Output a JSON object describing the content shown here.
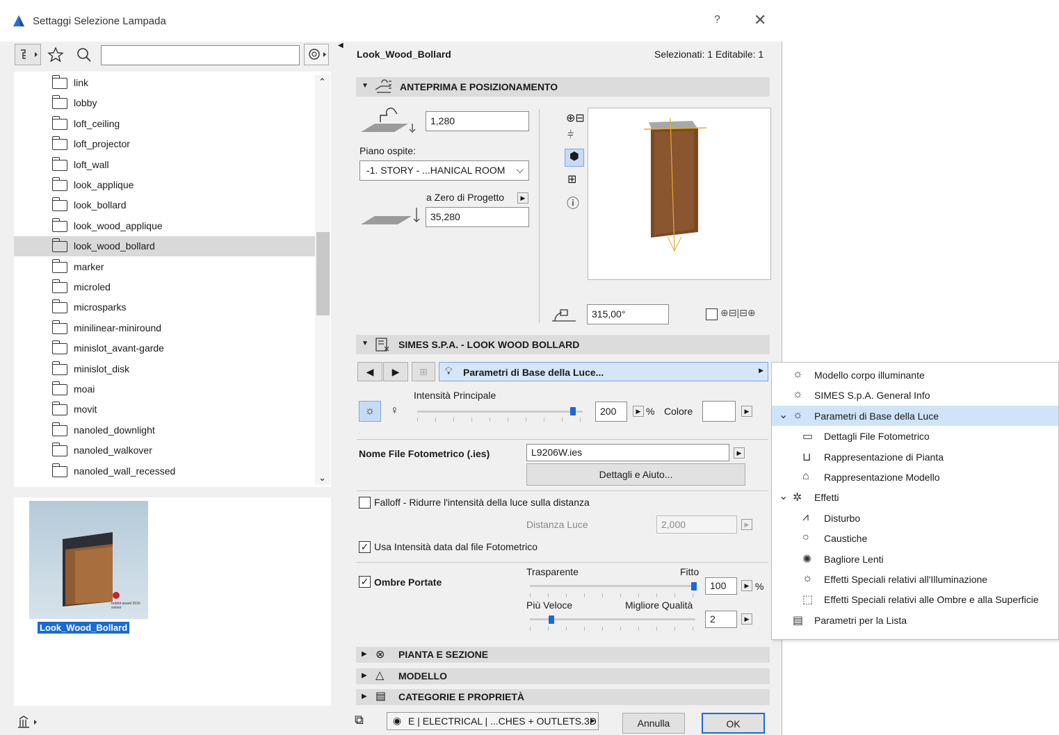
{
  "window": {
    "title": "Settaggi Selezione Lampada",
    "help": "?",
    "close": "✕"
  },
  "left": {
    "search_placeholder": "",
    "tree_items": [
      "link",
      "lobby",
      "loft_ceiling",
      "loft_projector",
      "loft_wall",
      "look_applique",
      "look_bollard",
      "look_wood_applique",
      "look_wood_bollard",
      "marker",
      "microled",
      "microsparks",
      "minilinear-miniround",
      "minislot_avant-garde",
      "minislot_disk",
      "moai",
      "movit",
      "nanoled_downlight",
      "nanoled_walkover",
      "nanoled_wall_recessed"
    ],
    "selected_item": "look_wood_bollard",
    "preview_caption": "Look_Wood_Bollard",
    "preview_badge": "reddot award 2016 winner"
  },
  "header": {
    "object_name": "Look_Wood_Bollard",
    "selection_info": "Selezionati: 1 Editabile: 1"
  },
  "anteprima": {
    "title": "ANTEPRIMA E POSIZIONAMENTO",
    "height_value": "1,280",
    "host_label": "Piano ospite:",
    "host_value": "-1. STORY - ...HANICAL ROOM",
    "ref_label": "a Zero di Progetto",
    "elev_value": "35,280",
    "angle_value": "315,00°"
  },
  "simes": {
    "title": "SIMES S.P.A. - LOOK WOOD BOLLARD",
    "page_selector": "Parametri di Base della Luce...",
    "intensity_label": "Intensità Principale",
    "intensity_value": "200",
    "intensity_unit": "%",
    "intensity_fraction": 0.94,
    "color_label": "Colore",
    "ies_label": "Nome File Fotometrico (.ies)",
    "ies_value": "L9206W.ies",
    "details_button": "Dettagli e Aiuto...",
    "falloff_label": "Falloff - Ridurre l'intensità della luce sulla distanza",
    "falloff_checked": false,
    "distance_label": "Distanza Luce",
    "distance_value": "2,000",
    "use_ies_label": "Usa Intensità data dal file Fotometrico",
    "use_ies_checked": true,
    "shadows_label": "Ombre Portate",
    "shadows_checked": true,
    "transparent_label": "Trasparente",
    "dense_label": "Fitto",
    "shadow_value": "100",
    "shadow_unit": "%",
    "shadow_fraction": 0.99,
    "faster_label": "Più Veloce",
    "quality_label": "Migliore Qualità",
    "quality_value": "2",
    "quality_fraction": 0.13
  },
  "sections": {
    "pianta": "PIANTA E SEZIONE",
    "modello": "MODELLO",
    "categorie": "CATEGORIE E PROPRIETÀ"
  },
  "footer": {
    "layer": "E | ELECTRICAL | ...CHES + OUTLETS.3D",
    "cancel": "Annulla",
    "ok": "OK"
  },
  "menu": {
    "items": [
      "Modello corpo illuminante",
      "SIMES S.p.A. General Info",
      "Parametri di Base della Luce",
      "Dettagli File Fotometrico",
      "Rappresentazione di Pianta",
      "Rappresentazione Modello",
      "Effetti",
      "Disturbo",
      "Caustiche",
      "Bagliore Lenti",
      "Effetti Speciali relativi all'Illuminazione",
      "Effetti Speciali relativi alle Ombre e alla Superficie",
      "Parametri per la Lista"
    ]
  },
  "colors": {
    "accent": "#1a6ad6",
    "menu_selected": "#cde4fa",
    "section_bg": "#dcdcdc"
  }
}
